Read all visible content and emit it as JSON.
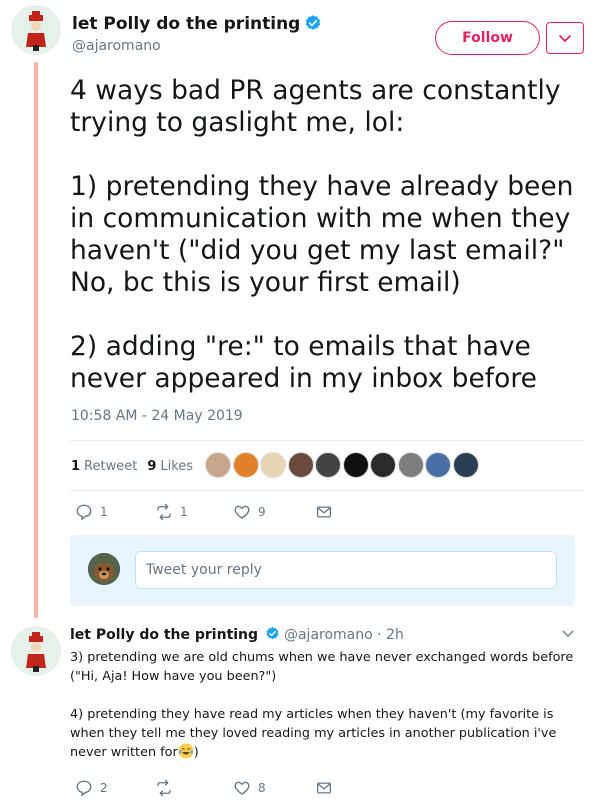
{
  "tweet": {
    "author_name": "let Polly do the printing",
    "author_handle": "@ajaromano",
    "follow_label": "Follow",
    "text": [
      "4 ways bad PR agents are constantly trying to gaslight me, lol:",
      "1) pretending they have already been in communication with me when they haven't (\"did you get my last email?\" No, bc this is your first email)",
      "2) adding \"re:\" to emails that have never appeared in my inbox before"
    ],
    "timestamp": "10:58 AM - 24 May 2019",
    "retweet_count": "1",
    "retweet_label": "Retweet",
    "like_count": "9",
    "like_label": "Likes",
    "actions": {
      "reply_count": "1",
      "retweet_count": "1",
      "like_count": "9"
    },
    "liker_colors": [
      "#c9a58c",
      "#e0802a",
      "#e8d3b5",
      "#6a4a3a",
      "#444444",
      "#101010",
      "#2a2a2a",
      "#7d7d7d",
      "#4a6fa5",
      "#2c3e55"
    ]
  },
  "reply_box": {
    "placeholder": "Tweet your reply"
  },
  "reply": {
    "author_name": "let Polly do the printing",
    "meta": "@ajaromano · 2h",
    "text_3": "3) pretending we are old chums when we have never exchanged words before (\"Hi, Aja! How have you been?\")",
    "text_4": "4) pretending they have read my articles when they haven't (my favorite is when they tell me they loved reading my articles in another publication i've never written for",
    "text_4_end": ")",
    "emoji": "joy-emoji",
    "actions": {
      "reply_count": "2",
      "retweet_count": "",
      "like_count": "8"
    }
  },
  "colors": {
    "accent": "#e0245e",
    "verified": "#1da1f2",
    "thread_line": "#f6b3a9",
    "muted": "#657786"
  }
}
